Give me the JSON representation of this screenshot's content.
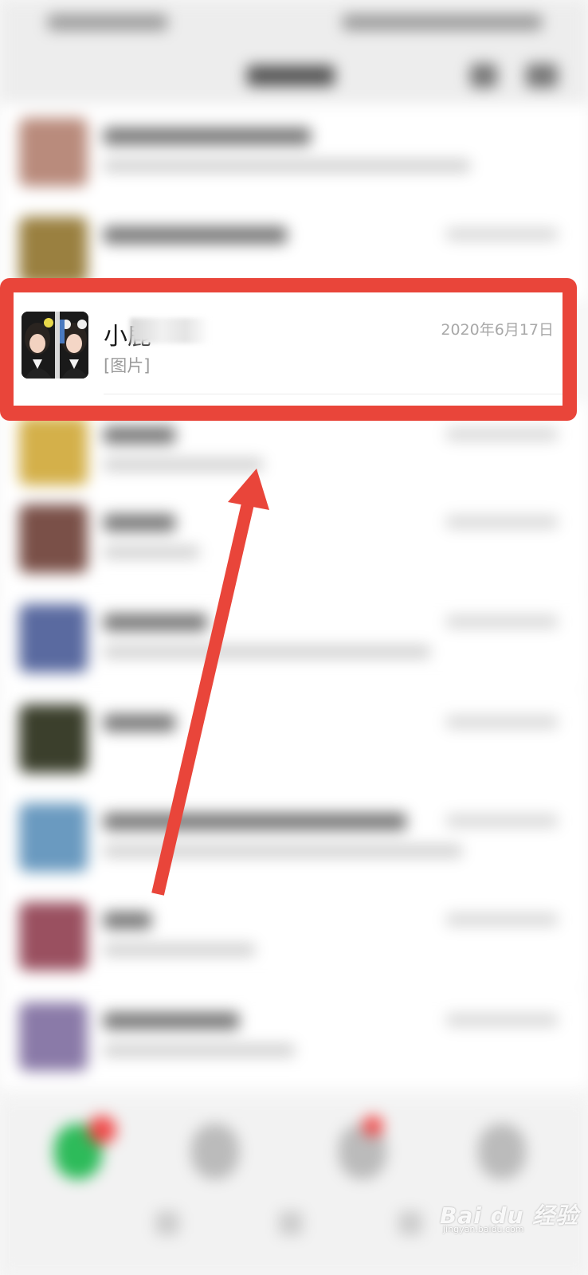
{
  "highlighted_chat": {
    "name": "小鹿",
    "preview": "[图片]",
    "time": "2020年6月17日"
  },
  "watermark": {
    "brand": "Bai du 经验",
    "url": "jingyan.baidu.com"
  },
  "colors": {
    "highlight_border": "#e9453a",
    "arrow": "#e9453a",
    "active_tab": "#2dbb5a",
    "badge": "#f04a4a"
  },
  "icons": [
    "chat-tab-icon",
    "contacts-tab-icon",
    "discover-tab-icon",
    "me-tab-icon",
    "search-icon",
    "add-icon"
  ]
}
